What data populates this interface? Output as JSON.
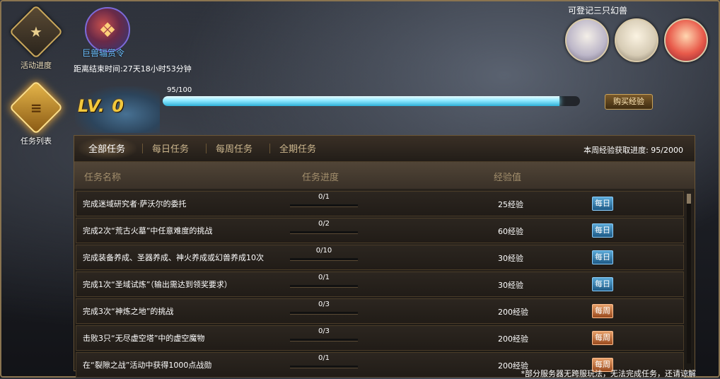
{
  "nav": [
    {
      "label": "活动进度",
      "icon": "star-medal-icon",
      "active": false
    },
    {
      "label": "任务列表",
      "icon": "scroll-medal-icon",
      "active": true
    }
  ],
  "order": {
    "name": "巨兽辐赏令",
    "countdown": "距离结束时间:27天18小时53分钟"
  },
  "beasts": {
    "title": "可登记三只幻兽",
    "items": [
      "white-beast-avatar",
      "silver-beast-avatar",
      "red-beast-avatar"
    ]
  },
  "level": {
    "label": "LV. 0",
    "exp_text": "95/100",
    "exp_fraction": 0.95,
    "buy_label": "购买经验"
  },
  "tabs": [
    "全部任务",
    "每日任务",
    "每周任务",
    "全期任务"
  ],
  "weekly_progress": "本周经验获取进度: 95/2000",
  "headers": [
    "任务名称",
    "任务进度",
    "经验值"
  ],
  "tasks": [
    {
      "name": "完成迷域研究者·萨沃尔的委托",
      "progress": "0/1",
      "frac": 0,
      "reward": "25经验",
      "type": "每日",
      "kind": "daily"
    },
    {
      "name": "完成2次“荒古火墓”中任意难度的挑战",
      "progress": "0/2",
      "frac": 0,
      "reward": "60经验",
      "type": "每日",
      "kind": "daily"
    },
    {
      "name": "完成装备养成、圣器养成、神火养成或幻兽养成10次",
      "progress": "0/10",
      "frac": 0,
      "reward": "30经验",
      "type": "每日",
      "kind": "daily"
    },
    {
      "name": "完成1次“圣域试炼”（输出需达到领奖要求）",
      "progress": "0/1",
      "frac": 0,
      "reward": "30经验",
      "type": "每日",
      "kind": "daily"
    },
    {
      "name": "完成3次“神炼之地”的挑战",
      "progress": "0/3",
      "frac": 0,
      "reward": "200经验",
      "type": "每周",
      "kind": "weekly"
    },
    {
      "name": "击败3只“无尽虚空塔”中的虚空魔物",
      "progress": "0/3",
      "frac": 0,
      "reward": "200经验",
      "type": "每周",
      "kind": "weekly"
    },
    {
      "name": "在“裂隙之战”活动中获得1000点战勋",
      "progress": "0/1",
      "frac": 0,
      "reward": "200经验",
      "type": "每周",
      "kind": "weekly"
    }
  ],
  "notice": "*部分服务器无跨服玩法，无法完成任务，还请谅解"
}
